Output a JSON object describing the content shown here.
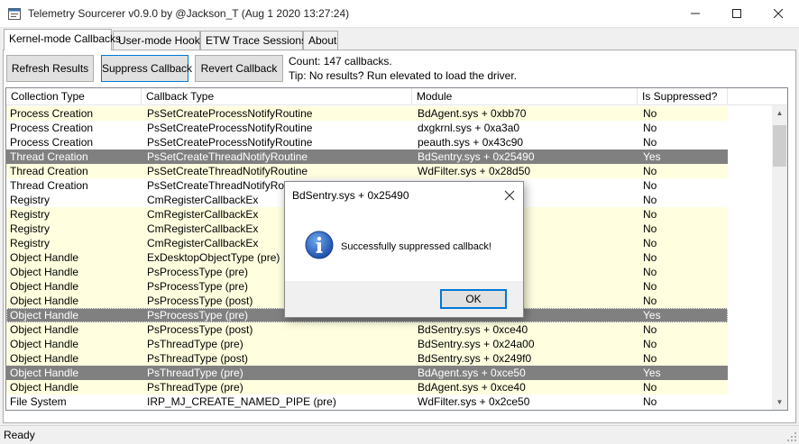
{
  "window": {
    "title": "Telemetry Sourcerer v0.9.0 by @Jackson_T (Aug  1 2020 13:27:24)",
    "minimize_icon": "minimize-icon",
    "maximize_icon": "maximize-icon",
    "close_icon": "close-icon"
  },
  "tabs": [
    {
      "label": "Kernel-mode Callbacks",
      "active": true
    },
    {
      "label": "User-mode Hooks",
      "active": false
    },
    {
      "label": "ETW Trace Sessions",
      "active": false
    },
    {
      "label": "About",
      "active": false
    }
  ],
  "toolbar": {
    "refresh_label": "Refresh Results",
    "suppress_label": "Suppress Callback",
    "revert_label": "Revert Callback",
    "count_text": "Count: 147 callbacks.",
    "tip_text": "Tip: No results? Run elevated to load the driver."
  },
  "table": {
    "columns": [
      "Collection Type",
      "Callback Type",
      "Module",
      "Is Suppressed?"
    ],
    "rows": [
      [
        "Process Creation",
        "PsSetCreateProcessNotifyRoutine",
        "BdAgent.sys + 0xbb70",
        "No"
      ],
      [
        "Process Creation",
        "PsSetCreateProcessNotifyRoutine",
        "dxgkrnl.sys + 0xa3a0",
        "No"
      ],
      [
        "Process Creation",
        "PsSetCreateProcessNotifyRoutine",
        "peauth.sys + 0x43c90",
        "No"
      ],
      [
        "Thread Creation",
        "PsSetCreateThreadNotifyRoutine",
        "BdSentry.sys + 0x25490",
        "Yes"
      ],
      [
        "Thread Creation",
        "PsSetCreateThreadNotifyRoutine",
        "WdFilter.sys + 0x28d50",
        "No"
      ],
      [
        "Thread Creation",
        "PsSetCreateThreadNotifyRoutine",
        "",
        "No"
      ],
      [
        "Registry",
        "CmRegisterCallbackEx",
        "",
        "No"
      ],
      [
        "Registry",
        "CmRegisterCallbackEx",
        "",
        "No"
      ],
      [
        "Registry",
        "CmRegisterCallbackEx",
        "",
        "No"
      ],
      [
        "Registry",
        "CmRegisterCallbackEx",
        "",
        "No"
      ],
      [
        "Object Handle",
        "ExDesktopObjectType (pre)",
        "",
        "No"
      ],
      [
        "Object Handle",
        "PsProcessType (pre)",
        "",
        "No"
      ],
      [
        "Object Handle",
        "PsProcessType (pre)",
        "",
        "No"
      ],
      [
        "Object Handle",
        "PsProcessType (post)",
        "",
        "No"
      ],
      [
        "Object Handle",
        "PsProcessType (pre)",
        "",
        "Yes"
      ],
      [
        "Object Handle",
        "PsProcessType (post)",
        "BdSentry.sys + 0xce40",
        "No"
      ],
      [
        "Object Handle",
        "PsThreadType (pre)",
        "BdSentry.sys + 0x24a00",
        "No"
      ],
      [
        "Object Handle",
        "PsThreadType (post)",
        "BdSentry.sys + 0x249f0",
        "No"
      ],
      [
        "Object Handle",
        "PsThreadType (pre)",
        "BdAgent.sys + 0xce50",
        "Yes"
      ],
      [
        "Object Handle",
        "PsThreadType (pre)",
        "BdAgent.sys + 0xce40",
        "No"
      ],
      [
        "File System",
        "IRP_MJ_CREATE_NAMED_PIPE (pre)",
        "WdFilter.sys + 0x2ce50",
        "No"
      ]
    ],
    "row_styles": [
      "yellow",
      "white",
      "white",
      "selected",
      "yellow",
      "white",
      "white",
      "yellow",
      "yellow",
      "yellow",
      "yellow",
      "yellow",
      "yellow",
      "yellow",
      "selected-focus",
      "yellow",
      "yellow",
      "yellow",
      "selected",
      "yellow",
      "white"
    ]
  },
  "status": {
    "text": "Ready"
  },
  "dialog": {
    "title": "BdSentry.sys + 0x25490",
    "message": "Successfully suppressed callback!",
    "ok_label": "OK",
    "icon": "info-icon"
  },
  "colors": {
    "row_yellow": "#ffffe0",
    "row_selected": "#808080",
    "accent": "#0078d7"
  }
}
